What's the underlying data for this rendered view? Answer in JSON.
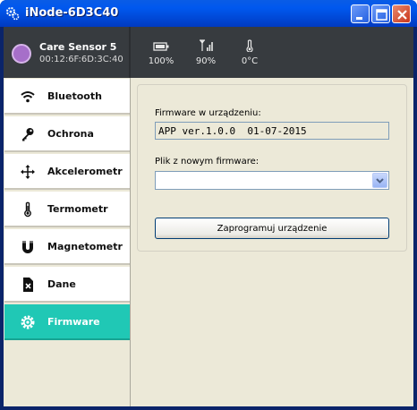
{
  "window": {
    "title": "iNode-6D3C40",
    "controls": [
      "minimize",
      "maximize",
      "close"
    ]
  },
  "device": {
    "name": "Care Sensor 5",
    "mac": "00:12:6F:6D:3C:40",
    "stats": [
      {
        "icon": "battery-icon",
        "value": "100%"
      },
      {
        "icon": "signal-icon",
        "value": "90%"
      },
      {
        "icon": "thermometer-icon",
        "value": "0°C"
      }
    ]
  },
  "sidebar": {
    "active": "Firmware",
    "accent_color": "#20c8b5",
    "items": [
      {
        "label": "Bluetooth",
        "icon": "wifi-icon"
      },
      {
        "label": "Ochrona",
        "icon": "key-icon"
      },
      {
        "label": "Akcelerometr",
        "icon": "move-arrows-icon"
      },
      {
        "label": "Termometr",
        "icon": "thermometer-icon"
      },
      {
        "label": "Magnetometr",
        "icon": "magnet-icon"
      },
      {
        "label": "Dane",
        "icon": "file-delete-icon"
      },
      {
        "label": "Firmware",
        "icon": "gear-icon"
      }
    ]
  },
  "firmware": {
    "current_label": "Firmware w urządzeniu:",
    "current_value": "APP ver.1.0.0  01-07-2015",
    "file_label": "Plik z nowym firmware:",
    "file_value": "",
    "program_button": "Zaprogramuj urządzenie"
  }
}
